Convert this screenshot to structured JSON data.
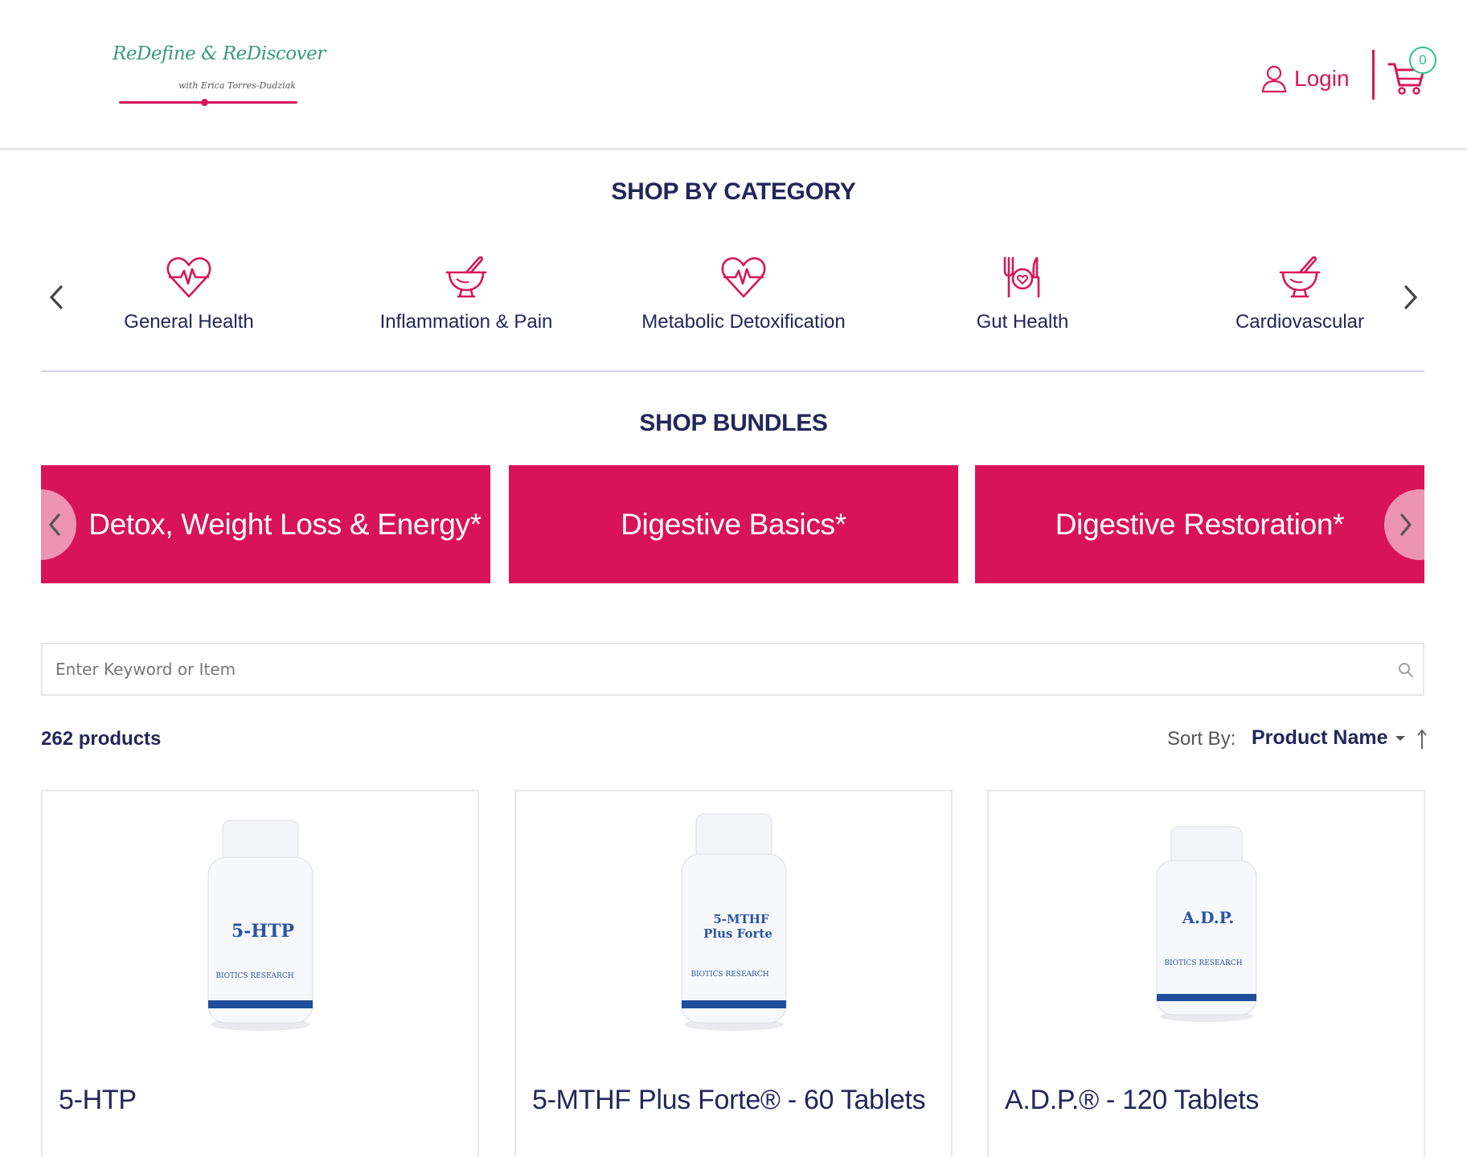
{
  "header": {
    "logo_text": "ReDefine & ReDiscover",
    "logo_subtext": "with Erica Torres-Dudziak",
    "login_label": "Login",
    "cart_count": "0"
  },
  "categories": {
    "title": "SHOP BY CATEGORY",
    "items": [
      {
        "label": "General Health",
        "icon": "heart-pulse-icon"
      },
      {
        "label": "Inflammation & Pain",
        "icon": "mortar-pestle-icon"
      },
      {
        "label": "Metabolic Detoxification",
        "icon": "heart-pulse-icon"
      },
      {
        "label": "Gut Health",
        "icon": "plate-fork-knife-icon"
      },
      {
        "label": "Cardiovascular",
        "icon": "mortar-pestle-icon"
      }
    ]
  },
  "bundles": {
    "title": "SHOP BUNDLES",
    "items": [
      {
        "label": "Detox, Weight Loss & Energy*"
      },
      {
        "label": "Digestive Basics*"
      },
      {
        "label": "Digestive Restoration*"
      }
    ]
  },
  "search": {
    "placeholder": "Enter Keyword or Item",
    "value": ""
  },
  "listing": {
    "count_label": "262 products",
    "sort_label": "Sort By:",
    "sort_value": "Product Name"
  },
  "products": [
    {
      "name": "5-HTP",
      "bottle_text": "5-HTP",
      "brand": "BIOTICS RESEARCH"
    },
    {
      "name": "5-MTHF Plus Forte® - 60 Tablets",
      "bottle_text": "5-MTHF Plus Forte",
      "brand": "BIOTICS RESEARCH"
    },
    {
      "name": "A.D.P.® - 120 Tablets",
      "bottle_text": "A.D.P.",
      "brand": "BIOTICS RESEARCH"
    }
  ],
  "colors": {
    "brand_pink": "#d91358",
    "navy": "#23265a",
    "badge_green": "#2fc08f"
  }
}
